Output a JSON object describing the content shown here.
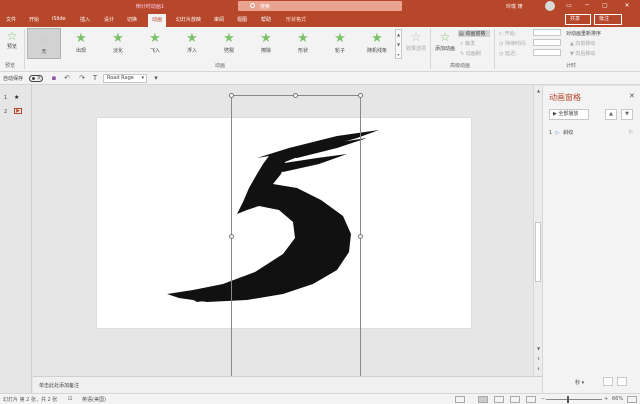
{
  "titlebar": {
    "doc_title": "倒计时动画1",
    "search_placeholder": "搜索",
    "user": "玲珑 燎",
    "min": "─",
    "restore": "▢",
    "close": "✕",
    "ribbon_opts": "▭"
  },
  "tabs": [
    {
      "label": "文件"
    },
    {
      "label": "开始"
    },
    {
      "label": "iSlide"
    },
    {
      "label": "插入"
    },
    {
      "label": "设计"
    },
    {
      "label": "切换"
    },
    {
      "label": "动画"
    },
    {
      "label": "幻灯片放映"
    },
    {
      "label": "审阅"
    },
    {
      "label": "视图"
    },
    {
      "label": "帮助"
    },
    {
      "label": "形状格式"
    }
  ],
  "share_label": "共享",
  "comment_label": "批注",
  "ribbon": {
    "preview_label": "预览",
    "preview_group": "预览",
    "animations": [
      {
        "label": "无"
      },
      {
        "label": "出现"
      },
      {
        "label": "淡化"
      },
      {
        "label": "飞入"
      },
      {
        "label": "浮入"
      },
      {
        "label": "劈裂"
      },
      {
        "label": "擦除"
      },
      {
        "label": "形状"
      },
      {
        "label": "轮子"
      },
      {
        "label": "随机线条"
      }
    ],
    "effect_options": "效果选项",
    "anim_group": "动画",
    "add_animation": "添加动画",
    "anim_pane": "动画窗格",
    "trigger": "触发",
    "anim_painter": "动画刷",
    "adv_group": "高级动画",
    "start": "开始:",
    "duration": "持续时间:",
    "delay": "延迟:",
    "reorder": "对动画重新排序",
    "move_earlier": "▲ 向前移动",
    "move_later": "▼ 向后移动",
    "timing_group": "计时"
  },
  "qat": {
    "autosave": "自动保存",
    "toggle": "关",
    "font": "Road Rage",
    "save_icon": "▪",
    "undo_icon": "↶",
    "redo_icon": "↷",
    "format_icon": "T"
  },
  "thumbs": [
    {
      "num": "1",
      "icon": "★"
    },
    {
      "num": "2",
      "icon": "▶"
    }
  ],
  "notes_placeholder": "单击此处添加备注",
  "pane": {
    "title": "动画窗格",
    "close": "✕",
    "play_all": "▶ 全部播放",
    "up": "▲",
    "down": "▼",
    "items": [
      {
        "index": "1",
        "label": "斜纹",
        "icon": "▷"
      }
    ],
    "seconds": "秒 ▾"
  },
  "statusbar": {
    "slide_info": "幻灯片 第 2 张，共 2 张",
    "language": "英语(美国)",
    "zoom": "66%"
  },
  "colors": {
    "accent": "#b7472a",
    "ribbon": "#f3f3f3",
    "star_green": "#7dc16b"
  }
}
